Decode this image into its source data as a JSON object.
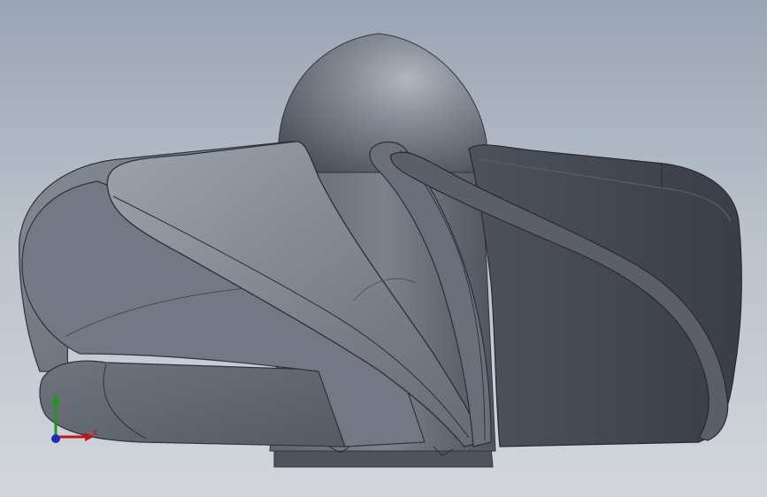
{
  "viewport": {
    "background_top": "#9aa5b4",
    "background_bottom": "#d2d6dc"
  },
  "model": {
    "name": "impeller-model",
    "material_color": "#6d727e",
    "shadow_color": "#3e424a",
    "highlight_color": "#a9adb7"
  },
  "triad": {
    "x_label": "X",
    "y_label": "Y",
    "x_color": "#c01818",
    "y_color": "#1a9a1a",
    "z_color": "#1c2fb8"
  }
}
